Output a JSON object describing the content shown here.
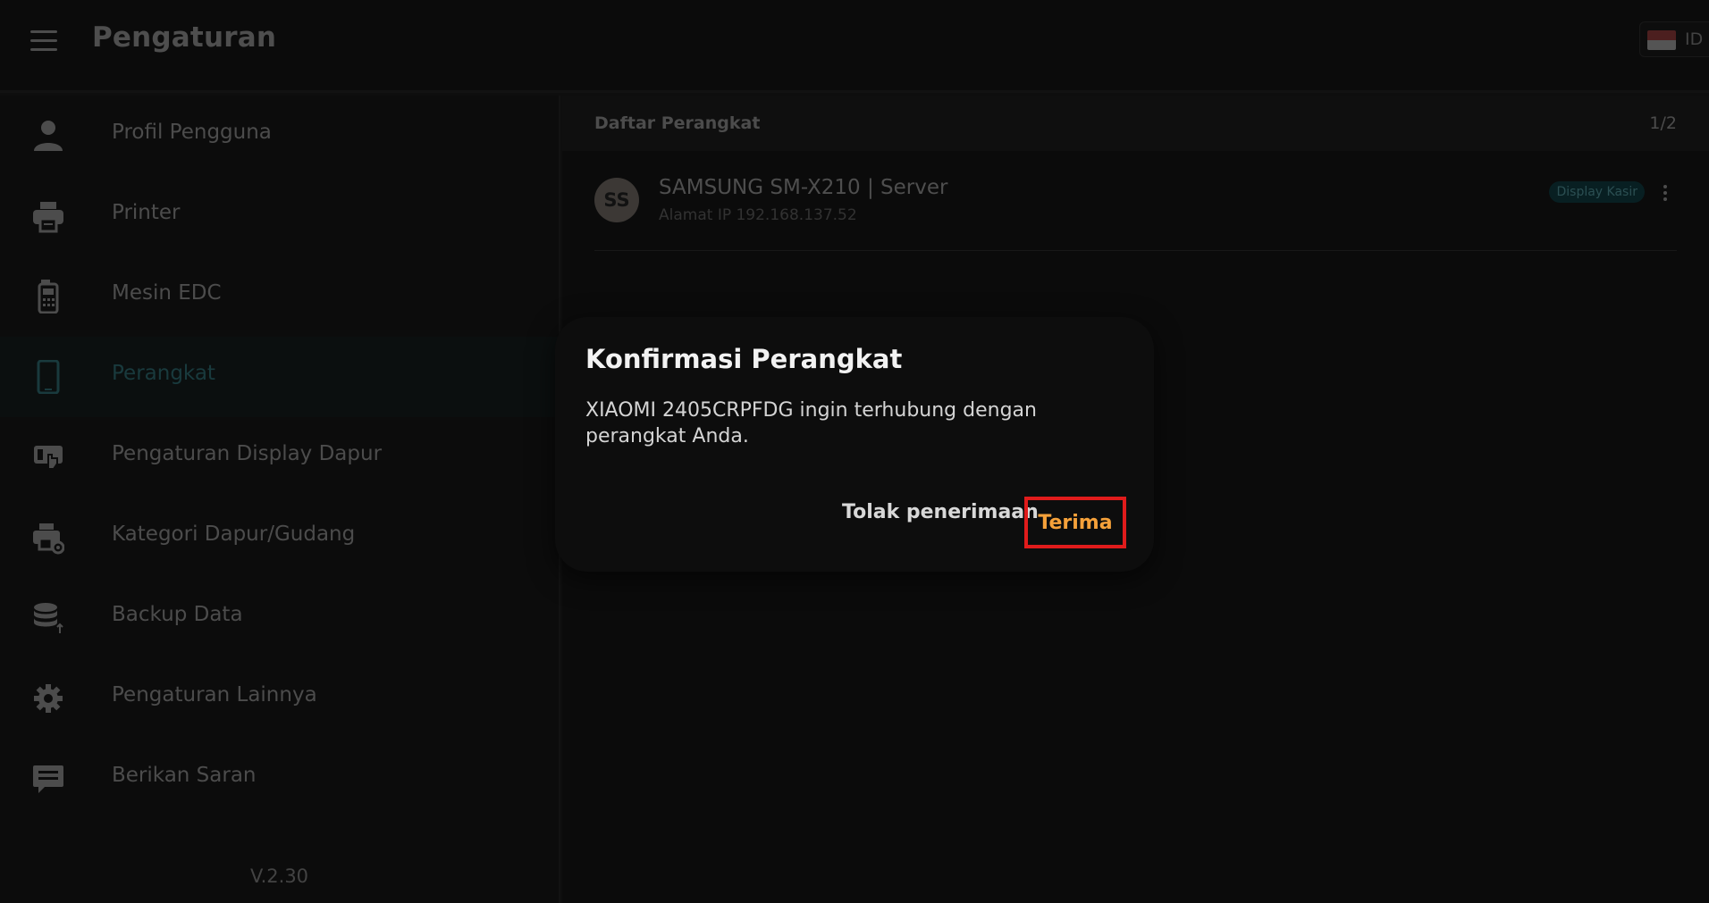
{
  "topbar": {
    "title": "Pengaturan",
    "language_code": "ID",
    "menu_icon": "menu-icon"
  },
  "sidebar": {
    "items": [
      {
        "label": "Profil Pengguna",
        "icon": "user-icon",
        "active": false
      },
      {
        "label": "Printer",
        "icon": "printer-icon",
        "active": false
      },
      {
        "label": "Mesin EDC",
        "icon": "edc-machine-icon",
        "active": false
      },
      {
        "label": "Perangkat",
        "icon": "tablet-icon",
        "active": true
      },
      {
        "label": "Pengaturan Display Dapur",
        "icon": "kitchen-display-icon",
        "active": false
      },
      {
        "label": "Kategori Dapur/Gudang",
        "icon": "printer-settings-icon",
        "active": false
      },
      {
        "label": "Backup Data",
        "icon": "database-upload-icon",
        "active": false
      },
      {
        "label": "Pengaturan Lainnya",
        "icon": "gear-icon",
        "active": false
      },
      {
        "label": "Berikan Saran",
        "icon": "feedback-icon",
        "active": false
      }
    ],
    "version": "V.2.30"
  },
  "device_list": {
    "title": "Daftar Perangkat",
    "page": "1/2",
    "devices": [
      {
        "avatar_initials": "SS",
        "name": "SAMSUNG SM-X210 | Server",
        "ip": "Alamat IP 192.168.137.52",
        "badge": "Display Kasir"
      }
    ]
  },
  "dialog": {
    "title": "Konfirmasi Perangkat",
    "message": "XIAOMI 2405CRPFDG ingin terhubung dengan perangkat Anda.",
    "reject_label": "Tolak penerimaan",
    "accept_label": "Terima"
  },
  "colors": {
    "accent_active": "#2e6a70",
    "accept_text": "#f5a13a",
    "highlight_border": "#e01b1b",
    "badge_bg": "#0f3a3f"
  }
}
